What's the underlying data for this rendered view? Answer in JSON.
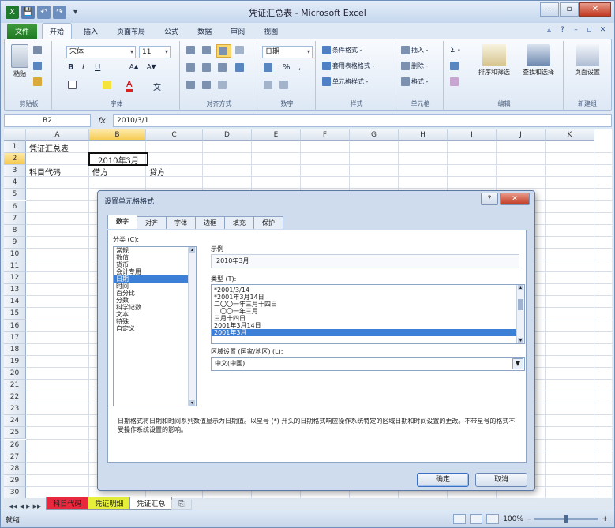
{
  "titlebar": {
    "title": "凭证汇总表 - Microsoft Excel",
    "minimize": "–",
    "restore": "▫",
    "close": "✕"
  },
  "quick_access": [
    "X",
    "💾",
    "↶",
    "↷",
    "▾"
  ],
  "ribbon_tabs": [
    {
      "label": "文件",
      "kind": "file"
    },
    {
      "label": "开始",
      "kind": "active"
    },
    {
      "label": "插入",
      "kind": ""
    },
    {
      "label": "页面布局",
      "kind": ""
    },
    {
      "label": "公式",
      "kind": ""
    },
    {
      "label": "数据",
      "kind": ""
    },
    {
      "label": "审阅",
      "kind": ""
    },
    {
      "label": "视图",
      "kind": ""
    }
  ],
  "ribbon": {
    "clipboard": {
      "label": "剪贴板",
      "paste": "粘贴"
    },
    "font": {
      "label": "字体",
      "name": "宋体",
      "size": "11",
      "bold": "B",
      "italic": "I",
      "underline": "U",
      "grow": "A▲",
      "shrink": "A▼",
      "color": "A",
      "wen": "文"
    },
    "alignment": {
      "label": "对齐方式"
    },
    "number": {
      "label": "数字",
      "format": "日期",
      "pct": "%",
      "comma": ","
    },
    "styles": {
      "label": "样式",
      "cond": "条件格式 -",
      "table": "套用表格格式 -",
      "cell": "单元格样式 -"
    },
    "cells": {
      "label": "单元格",
      "insert": "插入 -",
      "delete": "删除 -",
      "format": "格式 -"
    },
    "editing": {
      "label": "编辑",
      "sort": "排序和筛选",
      "find": "查找和选择",
      "sigma": "Σ -"
    },
    "newgroup": {
      "label": "新建组",
      "page": "页面设置"
    }
  },
  "formula_bar": {
    "name_box": "B2",
    "fx": "fx",
    "content": "2010/3/1"
  },
  "columns": [
    "A",
    "B",
    "C",
    "D",
    "E",
    "F",
    "G",
    "H",
    "I",
    "J",
    "K"
  ],
  "rows": [
    "1",
    "2",
    "3",
    "4",
    "5",
    "6",
    "7",
    "8",
    "9",
    "10",
    "11",
    "12",
    "13",
    "14",
    "15",
    "16",
    "17",
    "18",
    "19",
    "20",
    "21",
    "22",
    "23",
    "24",
    "25",
    "26",
    "27",
    "28",
    "29",
    "30"
  ],
  "cells": {
    "a1": "凭证汇总表",
    "b2": "2010年3月",
    "a3": "科目代码",
    "b3": "借方",
    "c3": "贷方"
  },
  "sheet_tabs": [
    {
      "label": "科目代码",
      "color": "#e8283c"
    },
    {
      "label": "凭证明细",
      "color": "#e6f03a"
    },
    {
      "label": "凭证汇总",
      "color": "#ffffff"
    }
  ],
  "status": {
    "ready": "就绪",
    "zoom": "100%",
    "minus": "–",
    "plus": "+"
  },
  "dialog": {
    "title": "设置单元格格式",
    "help": "?",
    "close": "✕",
    "tabs": [
      "数字",
      "对齐",
      "字体",
      "边框",
      "填充",
      "保护"
    ],
    "category_label": "分类 (C):",
    "categories": [
      "常规",
      "数值",
      "货币",
      "会计专用",
      "日期",
      "时间",
      "百分比",
      "分数",
      "科学记数",
      "文本",
      "特殊",
      "自定义"
    ],
    "category_selected": 4,
    "sample_label": "示例",
    "sample_value": "2010年3月",
    "type_label": "类型 (T):",
    "types": [
      "*2001/3/14",
      "*2001年3月14日",
      "二〇〇一年三月十四日",
      "二〇〇一年三月",
      "三月十四日",
      "2001年3月14日",
      "2001年3月"
    ],
    "type_selected": 6,
    "locale_label": "区域设置 (国家/地区) (L):",
    "locale_value": "中文(中国)",
    "description": "日期格式将日期和时间系列数值显示为日期值。以星号 (*) 开头的日期格式响应操作系统特定的区域日期和时间设置的更改。不带星号的格式不受操作系统设置的影响。",
    "ok": "确定",
    "cancel": "取消"
  }
}
